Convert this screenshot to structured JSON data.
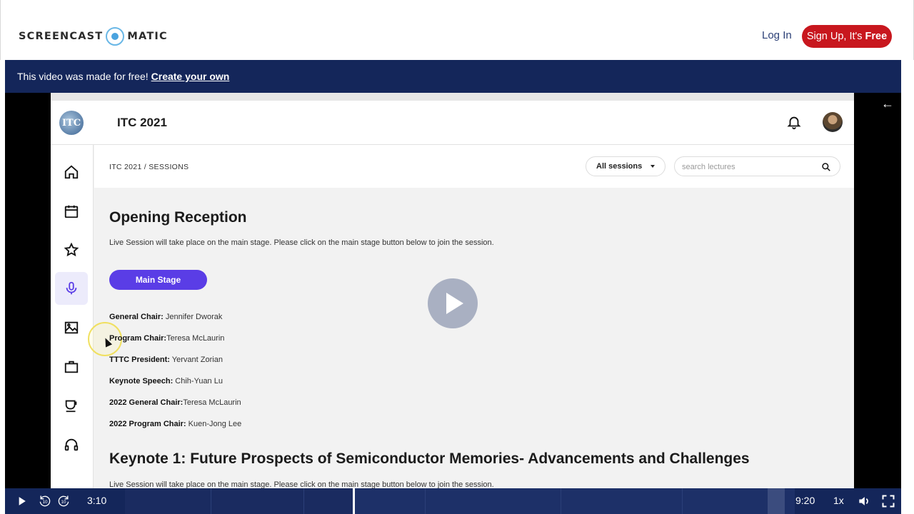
{
  "header": {
    "logo_left": "SCREENCAST",
    "logo_right": "MATIC",
    "login_label": "Log In",
    "signup_label": "Sign Up, It's",
    "signup_bold": "Free"
  },
  "banner": {
    "text": "This video was made for free!",
    "link": "Create your own"
  },
  "app": {
    "logo_text": "ITC",
    "title": "ITC 2021",
    "breadcrumb": "ITC 2021 / SESSIONS",
    "filter_selected": "All sessions",
    "search_placeholder": "search lectures",
    "sidebar_icons": [
      "home-icon",
      "calendar-icon",
      "star-icon",
      "microphone-icon",
      "image-icon",
      "briefcase-icon",
      "coffee-cup-icon",
      "headset-icon"
    ],
    "session1": {
      "title": "Opening Reception",
      "description": "Live Session will take place on the main stage. Please click on the main stage button below to join the session.",
      "button": "Main Stage",
      "roles": [
        {
          "label": "General Chair:",
          "name": " Jennifer Dworak"
        },
        {
          "label": "Program Chair:",
          "name": "Teresa McLaurin"
        },
        {
          "label": "TTTC President:",
          "name": " Yervant Zorian"
        },
        {
          "label": "Keynote Speech:",
          "name": " Chih-Yuan Lu"
        },
        {
          "label": "2022 General Chair:",
          "name": "Teresa McLaurin"
        },
        {
          "label": "2022 Program Chair:",
          "name": " Kuen-Jong Lee"
        }
      ]
    },
    "session2": {
      "title": "Keynote 1: Future Prospects of Semiconductor Memories- Advancements and Challenges",
      "description": "Live Session will take place on the main stage. Please click on the main stage button below to join the session."
    }
  },
  "player": {
    "current_time": "3:10",
    "duration": "9:20",
    "speed": "1x",
    "skip_back": "10",
    "skip_forward": "10",
    "progress_fraction": 0.34
  },
  "colors": {
    "brand_red": "#c8171e",
    "banner_navy": "#14265a",
    "accent_purple": "#5a3de6"
  }
}
